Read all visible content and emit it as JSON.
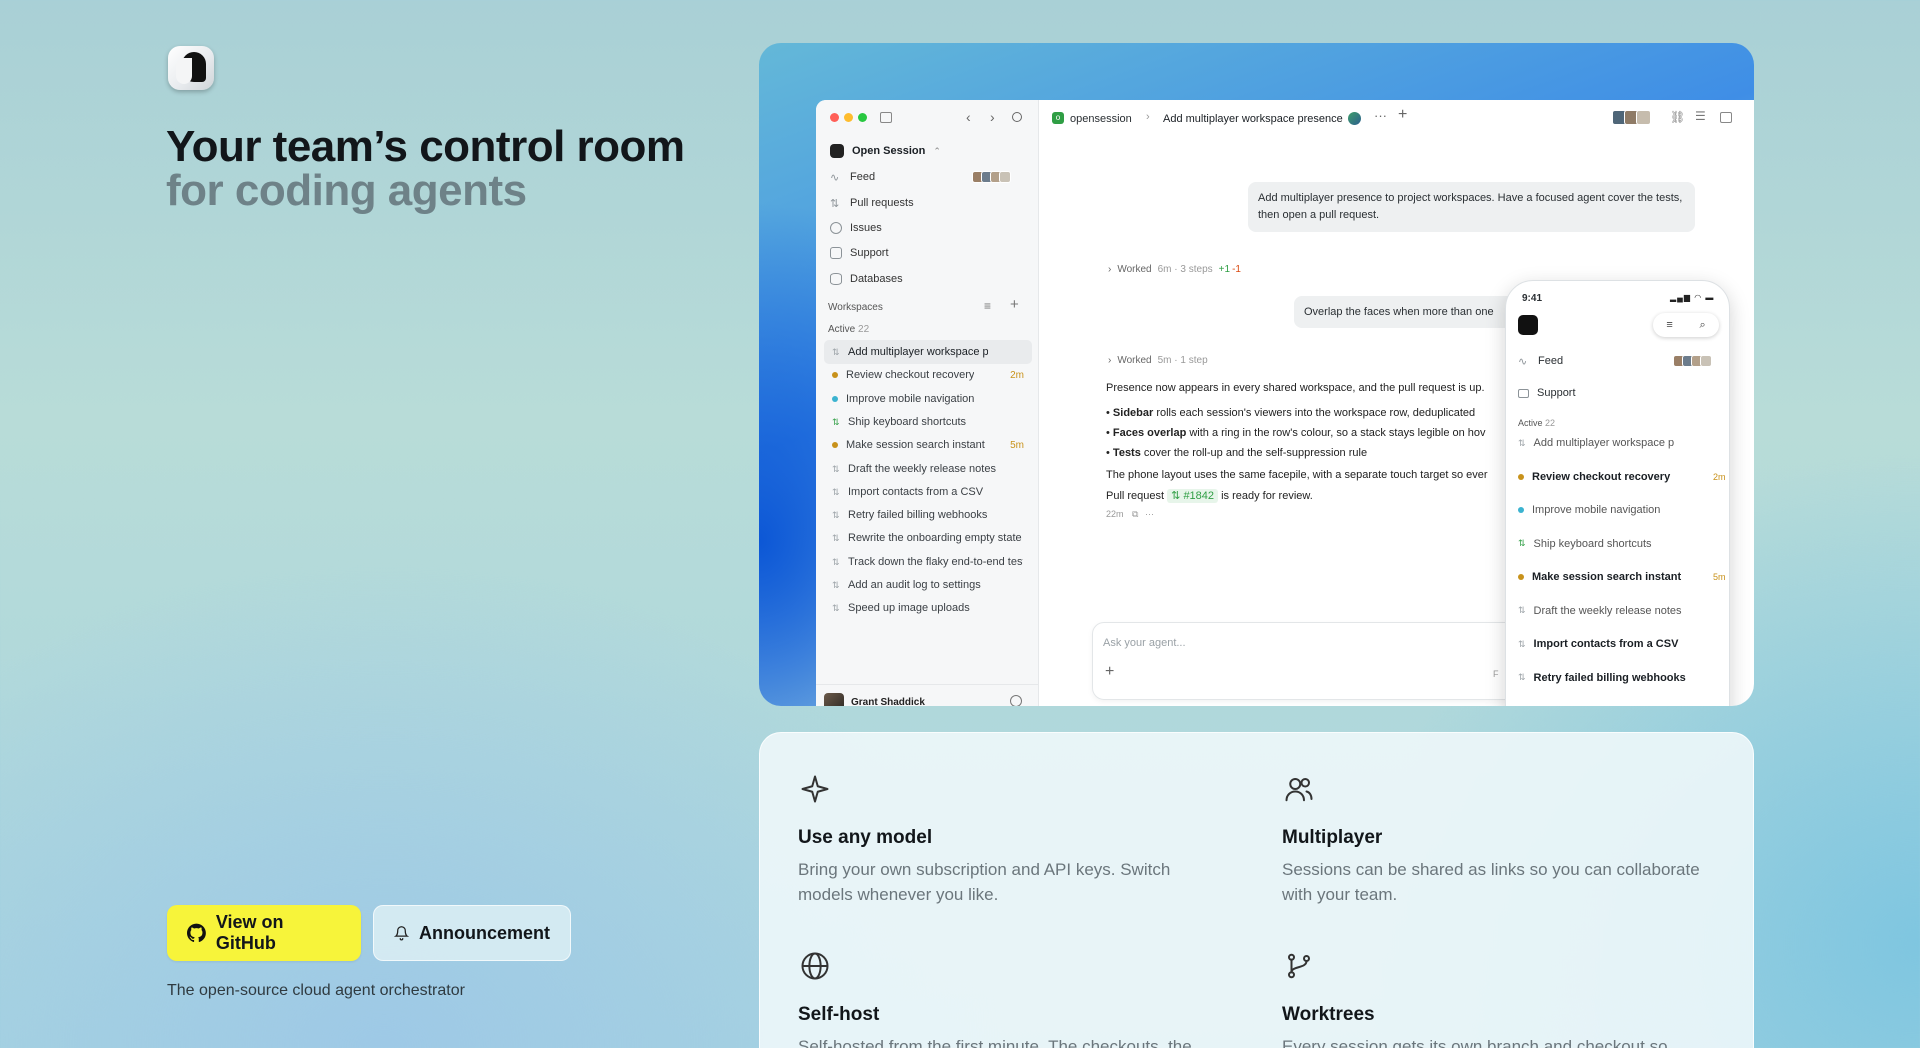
{
  "hero": {
    "title_line1": "Your team’s control room",
    "title_line2": "for coding agents",
    "tagline": "The open-source cloud agent orchestrator"
  },
  "buttons": {
    "github": "View on GitHub",
    "announcement": "Announcement"
  },
  "app": {
    "org": "Open Session",
    "nav": [
      "Feed",
      "Pull requests",
      "Issues",
      "Support",
      "Databases"
    ],
    "workspaces_label": "Workspaces",
    "active_label": "Active",
    "active_count": "22",
    "workspaces": [
      {
        "title": "Add multiplayer workspace presence",
        "time": ""
      },
      {
        "title": "Review checkout recovery",
        "time": "2m"
      },
      {
        "title": "Improve mobile navigation",
        "time": ""
      },
      {
        "title": "Ship keyboard shortcuts",
        "time": ""
      },
      {
        "title": "Make session search instant",
        "time": "5m"
      },
      {
        "title": "Draft the weekly release notes",
        "time": ""
      },
      {
        "title": "Import contacts from a CSV",
        "time": ""
      },
      {
        "title": "Retry failed billing webhooks",
        "time": ""
      },
      {
        "title": "Rewrite the onboarding empty state",
        "time": ""
      },
      {
        "title": "Track down the flaky end-to-end test",
        "time": ""
      },
      {
        "title": "Add an audit log to settings",
        "time": ""
      },
      {
        "title": "Speed up image uploads",
        "time": ""
      }
    ],
    "user": "Grant Shaddick",
    "breadcrumb_repo": "opensession",
    "breadcrumb_title": "Add multiplayer workspace presence",
    "msg1": "Add multiplayer presence to project workspaces. Have a focused agent cover the tests, then open a pull request.",
    "worked1": {
      "label": "Worked",
      "meta": "6m · 3 steps",
      "plus": "+1",
      "minus": "-1"
    },
    "msg2": "Overlap the faces when more than one",
    "worked2": {
      "label": "Worked",
      "meta": "5m · 1 step"
    },
    "reply_intro": "Presence now appears in every shared workspace, and the pull request is up.",
    "bullets": [
      {
        "bold": "Sidebar",
        "text": " rolls each session's viewers into the workspace row, deduplicated"
      },
      {
        "bold": "Faces overlap",
        "text": " with a ring in the row's colour, so a stack stays legible on hov"
      },
      {
        "bold": "Tests",
        "text": " cover the roll-up and the self-suppression rule"
      }
    ],
    "phone_note": "The phone layout uses the same facepile, with a separate touch target so ever",
    "pr_prefix": "Pull request",
    "pr_number": "#1842",
    "pr_suffix": "is ready for review.",
    "reply_time": "22m",
    "input_placeholder": "Ask your agent...",
    "input_hint": "F"
  },
  "phone": {
    "time": "9:41",
    "nav": [
      "Feed",
      "Support"
    ],
    "active_label": "Active",
    "active_count": "22",
    "items": [
      {
        "title": "Add multiplayer workspace p",
        "time": "",
        "bold": false
      },
      {
        "title": "Review checkout recovery",
        "time": "2m",
        "bold": true
      },
      {
        "title": "Improve mobile navigation",
        "time": "",
        "bold": false
      },
      {
        "title": "Ship keyboard shortcuts",
        "time": "",
        "bold": false
      },
      {
        "title": "Make session search instant",
        "time": "5m",
        "bold": true
      },
      {
        "title": "Draft the weekly release notes",
        "time": "",
        "bold": false
      },
      {
        "title": "Import contacts from a CSV",
        "time": "",
        "bold": true
      },
      {
        "title": "Retry failed billing webhooks",
        "time": "",
        "bold": true
      }
    ]
  },
  "features": [
    {
      "icon": "sparkle-icon",
      "title": "Use any model",
      "desc": "Bring your own subscription and API keys. Switch models whenever you like."
    },
    {
      "icon": "users-icon",
      "title": "Multiplayer",
      "desc": "Sessions can be shared as links so you can collaborate with your team."
    },
    {
      "icon": "globe-icon",
      "title": "Self-host",
      "desc": "Self-hosted from the first minute. The checkouts, the"
    },
    {
      "icon": "git-branch-icon",
      "title": "Worktrees",
      "desc": "Every session gets its own branch and checkout so"
    }
  ],
  "colors": {
    "github_button": "#f7f43a",
    "accent_green": "#2f9e44",
    "time_amber": "#c8921b"
  }
}
